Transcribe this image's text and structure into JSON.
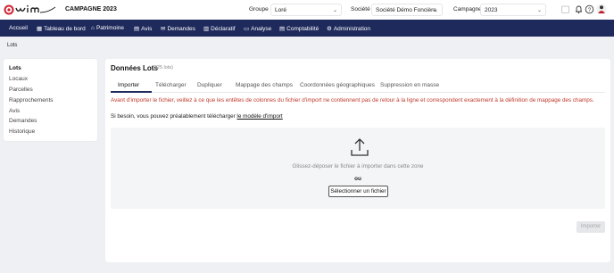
{
  "header": {
    "campaign_title": "CAMPAGNE 2023",
    "groupe": {
      "label": "Groupe :",
      "value": "Loré"
    },
    "societe": {
      "label": "Société :",
      "value": "Société Démo Foncière"
    },
    "campagne": {
      "label": "Campagne :",
      "value": "2023"
    }
  },
  "nav": [
    {
      "label": "Accueil",
      "icon": ""
    },
    {
      "label": "Tableau de bord",
      "icon": "grid-icon"
    },
    {
      "label": "Patrimoine",
      "icon": "home-icon"
    },
    {
      "label": "Avis",
      "icon": "document-icon"
    },
    {
      "label": "Demandes",
      "icon": "mail-icon"
    },
    {
      "label": "Déclaratif",
      "icon": "calculator-icon"
    },
    {
      "label": "Analyse",
      "icon": "folder-icon"
    },
    {
      "label": "Comptabilité",
      "icon": "ledger-icon"
    },
    {
      "label": "Administration",
      "icon": "gear-icon"
    }
  ],
  "breadcrumb": "Lots",
  "sidebar": {
    "items": [
      {
        "label": "Lots",
        "active": true
      },
      {
        "label": "Locaux"
      },
      {
        "label": "Parcelles"
      },
      {
        "label": "Rapprochements"
      },
      {
        "label": "Avis"
      },
      {
        "label": "Demandes"
      },
      {
        "label": "Historique"
      }
    ]
  },
  "main": {
    "title": "Données Lots",
    "count": "(225 lots)",
    "tabs": [
      {
        "label": "Importer",
        "active": true
      },
      {
        "label": "Télécharger"
      },
      {
        "label": "Dupliquer"
      },
      {
        "label": "Mappage des champs"
      },
      {
        "label": "Coordonnées géographiques"
      },
      {
        "label": "Suppression en masse"
      }
    ],
    "warning": "Avant d'importer le fichier, veillez à ce que les entêtes de colonnes du fichier d'import ne contiennent pas de retour à la ligne et correspondent exactement à la définition de mappage des champs.",
    "hint_prefix": "Si besoin, vous pouvez préalablement télécharger ",
    "hint_link": "le modèle d'import",
    "drop_text": "Glissez-déposer le fichier à importer dans cette zone",
    "or_text": "ou",
    "select_button": "Sélectionner un fichier",
    "import_button": "Importer"
  },
  "colors": {
    "nav_bg": "#1e2a5c",
    "warning": "#c0392b",
    "logo_red": "#d0202e"
  }
}
